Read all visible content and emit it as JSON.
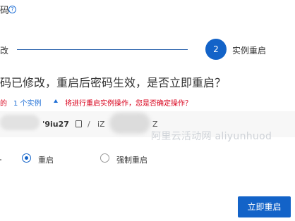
{
  "header": {
    "title": "码",
    "help_icon": "question-circle-icon",
    "help_glyph": "?"
  },
  "steps": {
    "step1_label": "改",
    "step2_number": "2",
    "step2_label": "实例重启",
    "active_color": "#1363c8"
  },
  "dialog": {
    "question": "码已修改，重启后密码生效，是否立即重启？",
    "warning_prefix": "的",
    "instance_count_link": "1 个实例",
    "warning_text": "将进行重启实例操作，您是否确定操作？",
    "warning_color": "#d9001b"
  },
  "instance": {
    "id_fragment": "'9iu27",
    "separator": "/",
    "host_prefix": "iZ",
    "host_suffix": "Z"
  },
  "watermark": "阿里云活动网  aliyunhuod",
  "restart_options": {
    "selected": "重启",
    "options": [
      {
        "label": "重启",
        "checked": true
      },
      {
        "label": "强制重启",
        "checked": false
      }
    ]
  },
  "footer": {
    "restart_now_label": "立即重启",
    "button_color": "#1363c8"
  }
}
